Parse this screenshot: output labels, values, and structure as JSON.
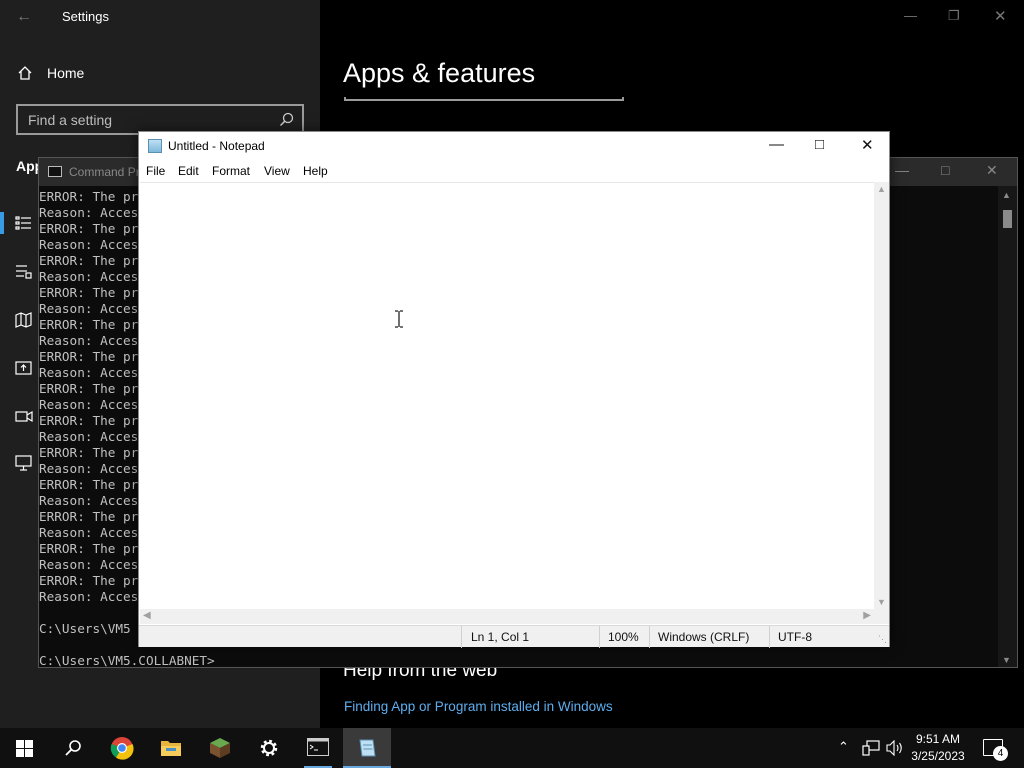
{
  "settings": {
    "title": "Settings",
    "home_label": "Home",
    "search_placeholder": "Find a setting",
    "section_partial": "App",
    "page_title": "Apps & features",
    "help_title": "Help from the web",
    "help_link": "Finding App or Program installed in Windows"
  },
  "cmd": {
    "title": "Command Pr",
    "lines": [
      "ERROR: The pr",
      "Reason: Acces",
      "ERROR: The pr",
      "Reason: Acces",
      "ERROR: The pr",
      "Reason: Acces",
      "ERROR: The pr",
      "Reason: Acces",
      "ERROR: The pr",
      "Reason: Acces",
      "ERROR: The pr",
      "Reason: Acces",
      "ERROR: The pr",
      "Reason: Acces",
      "ERROR: The pr",
      "Reason: Acces",
      "ERROR: The pr",
      "Reason: Acces",
      "ERROR: The pr",
      "Reason: Acces",
      "ERROR: The pr",
      "Reason: Acces",
      "ERROR: The pr",
      "Reason: Acces",
      "ERROR: The pr",
      "Reason: Acces",
      "",
      "C:\\Users\\VM5",
      "",
      "C:\\Users\\VM5.COLLABNET>"
    ]
  },
  "notepad": {
    "title": "Untitled - Notepad",
    "menu": [
      "File",
      "Edit",
      "Format",
      "View",
      "Help"
    ],
    "status": {
      "position": "Ln 1, Col 1",
      "zoom": "100%",
      "line_ending": "Windows (CRLF)",
      "encoding": "UTF-8"
    }
  },
  "taskbar": {
    "apps": [
      "start-icon",
      "search-icon",
      "chrome-icon",
      "file-explorer-icon",
      "minecraft-icon",
      "settings-icon",
      "command-prompt-icon",
      "notepad-icon"
    ],
    "time": "9:51 AM",
    "date": "3/25/2023",
    "notification_count": "4"
  },
  "colors": {
    "settings_nav_bg": "#1f1f1f",
    "accent": "#3a9be5",
    "link": "#5eaef0"
  }
}
